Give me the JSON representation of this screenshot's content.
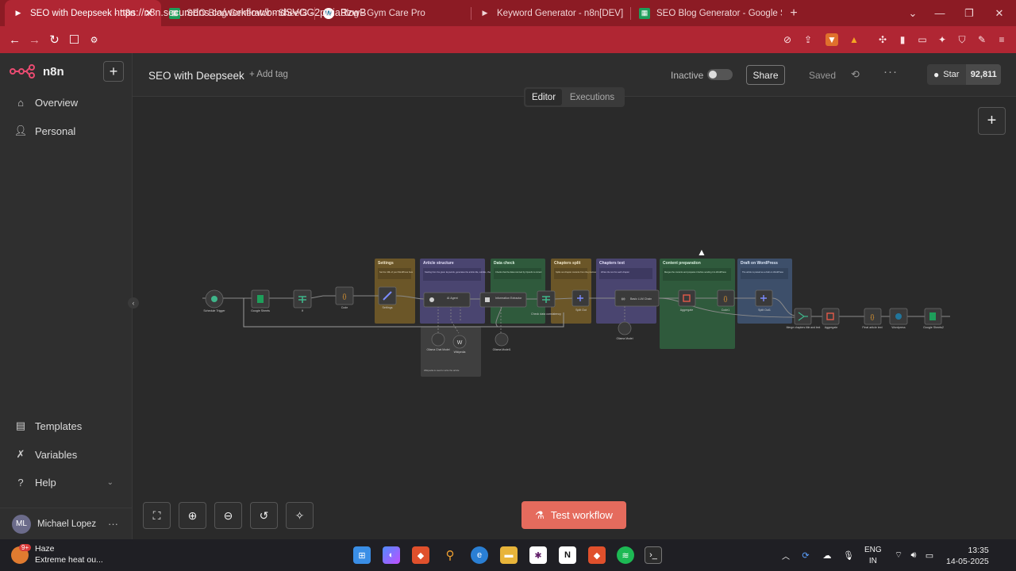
{
  "browser": {
    "tabs": [
      {
        "title": "SEO with Deepseek - n8n",
        "icon": "play-icon",
        "active": true
      },
      {
        "title": "SEO Blog Generator - Sheet3 - Goo",
        "icon": "sheets-icon",
        "active": false
      },
      {
        "title": "Blog - Gym Care Pro",
        "icon": "wordpress-icon",
        "active": false
      },
      {
        "title": "Keyword Generator - n8n[DEV]",
        "icon": "play-icon",
        "active": false
      },
      {
        "title": "SEO Blog Generator - Google Sheet",
        "icon": "sheets-icon",
        "active": false
      }
    ],
    "url": "https://n8n.securedns.ca/workflow/bmdSVGG2pDiaRzwB"
  },
  "app": {
    "logo": "n8n",
    "sidebar": {
      "items": [
        {
          "label": "Overview",
          "icon": "home-icon"
        },
        {
          "label": "Personal",
          "icon": "user-icon"
        }
      ],
      "bottom_items": [
        {
          "label": "Templates",
          "icon": "templates-icon"
        },
        {
          "label": "Variables",
          "icon": "variables-icon"
        },
        {
          "label": "Help",
          "icon": "help-icon"
        }
      ],
      "user": {
        "initials": "ML",
        "name": "Michael Lopez"
      }
    },
    "header": {
      "workflow_title": "SEO with Deepseek",
      "add_tag": "+ Add tag",
      "status": "Inactive",
      "share": "Share",
      "saved": "Saved",
      "github_star": "Star",
      "github_count": "92,811"
    },
    "view_tabs": [
      "Editor",
      "Executions"
    ],
    "test_button": "Test workflow"
  },
  "workflow": {
    "groups": [
      {
        "title": "Settings",
        "note": "Set the URL of your WordPress here",
        "color": "#6b5628"
      },
      {
        "title": "Article structure",
        "note": "Starting from the given keywords, generates the article title, subtitle, chapters, and images prompt",
        "color": "#4a4570"
      },
      {
        "title": "Data check",
        "note": "Checks that the data returned by OpenAI is correct",
        "color": "#2f5a3c"
      },
      {
        "title": "Chapters split",
        "note": "Splits out chapter contents from the previous node",
        "color": "#6b5628"
      },
      {
        "title": "Chapters text",
        "note": "Writes the text for each chapter",
        "color": "#4a4570"
      },
      {
        "title": "Content preparation",
        "note": "Merges the contents and prepares it before sending it to WordPress",
        "color": "#2f5a3c"
      },
      {
        "title": "Draft on WordPress",
        "note": "The article is posted as a draft on WordPress",
        "color": "#3d4f6a"
      }
    ],
    "nodes": [
      {
        "label": "Schedule Trigger",
        "icon": "clock-icon"
      },
      {
        "label": "Google Sheets",
        "icon": "sheets-icon"
      },
      {
        "label": "If",
        "icon": "if-icon"
      },
      {
        "label": "Code",
        "icon": "code-icon"
      },
      {
        "label": "Settings",
        "icon": "pencil-icon"
      },
      {
        "label": "AI Agent",
        "icon": "robot-icon"
      },
      {
        "label": "Information Extractor",
        "icon": "extract-icon"
      },
      {
        "label": "Check data consistency",
        "icon": "if-icon"
      },
      {
        "label": "Split Out",
        "icon": "split-icon"
      },
      {
        "label": "Basic LLM Chain",
        "icon": "link-icon"
      },
      {
        "label": "Aggregate",
        "icon": "aggregate-icon"
      },
      {
        "label": "Code1",
        "icon": "code-icon"
      },
      {
        "label": "Split Out1",
        "icon": "split-icon"
      },
      {
        "label": "Merge chapters title and text",
        "icon": "merge-icon"
      },
      {
        "label": "Aggregate",
        "icon": "aggregate-icon"
      },
      {
        "label": "Final article text",
        "icon": "code-icon"
      },
      {
        "label": "Wordpress",
        "icon": "wordpress-icon"
      },
      {
        "label": "Google Sheets2",
        "icon": "sheets-icon"
      }
    ],
    "sub_nodes": [
      {
        "label": "Ollama Chat Model"
      },
      {
        "label": "Wikipedia"
      },
      {
        "label": "Ollama Model1"
      },
      {
        "label": "Ollama Model"
      }
    ],
    "wiki_note": "Wikipedia is used to write the article"
  },
  "taskbar": {
    "weather_title": "Haze",
    "weather_sub": "Extreme heat ou...",
    "badge": "9+",
    "lang_top": "ENG",
    "lang_bottom": "IN",
    "time": "13:35",
    "date": "14-05-2025"
  },
  "colors": {
    "accent": "#e56b5d",
    "browser_frame": "#b02633"
  }
}
